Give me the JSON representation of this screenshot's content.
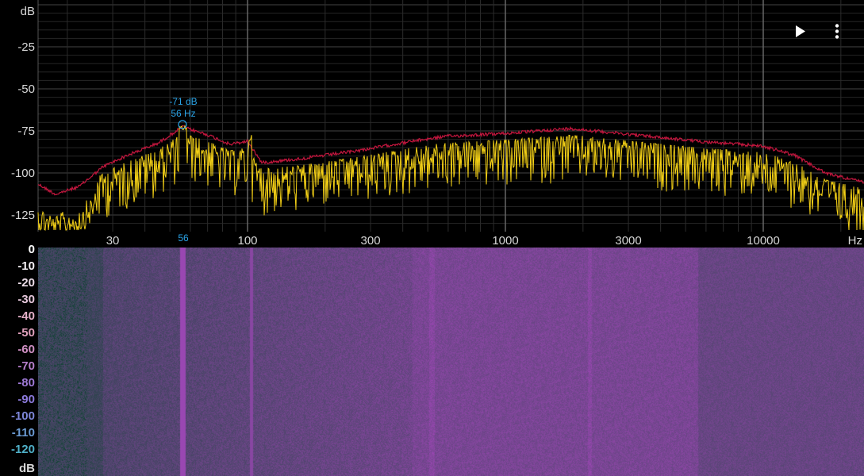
{
  "colors": {
    "background": "#000000",
    "grid": "#333333",
    "peak_trace": "#c4163e",
    "live_trace": "#f2cf16",
    "marker": "#2aa4e8",
    "spectro_low": "#0c2a2e",
    "spectro_high": "#b25fc9"
  },
  "spectrum": {
    "y_unit": "dB",
    "y_ticks": [
      "-25",
      "-50",
      "-75",
      "-100",
      "-125"
    ],
    "x_unit": "Hz",
    "x_ticks": [
      "30",
      "100",
      "300",
      "1000",
      "3000",
      "10000"
    ],
    "marker": {
      "db_label": "-71 dB",
      "hz_label": "56 Hz",
      "axis_label": "56"
    }
  },
  "spectrogram": {
    "unit": "dB",
    "scale_labels": [
      "0",
      "-10",
      "-20",
      "-30",
      "-40",
      "-50",
      "-60",
      "-70",
      "-80",
      "-90",
      "-100",
      "-110",
      "-120"
    ],
    "scale_colors": [
      "#ffffff",
      "#f4f0f4",
      "#ecdde8",
      "#e6c8dc",
      "#e4b0c8",
      "#e0a0bc",
      "#d090c4",
      "#b67ecb",
      "#9e79d6",
      "#8c7adc",
      "#7d86d8",
      "#6a9ad2",
      "#4fb0c8"
    ]
  },
  "toolbar": {
    "play_icon": "play-icon",
    "menu_icon": "more-vert-icon"
  }
}
